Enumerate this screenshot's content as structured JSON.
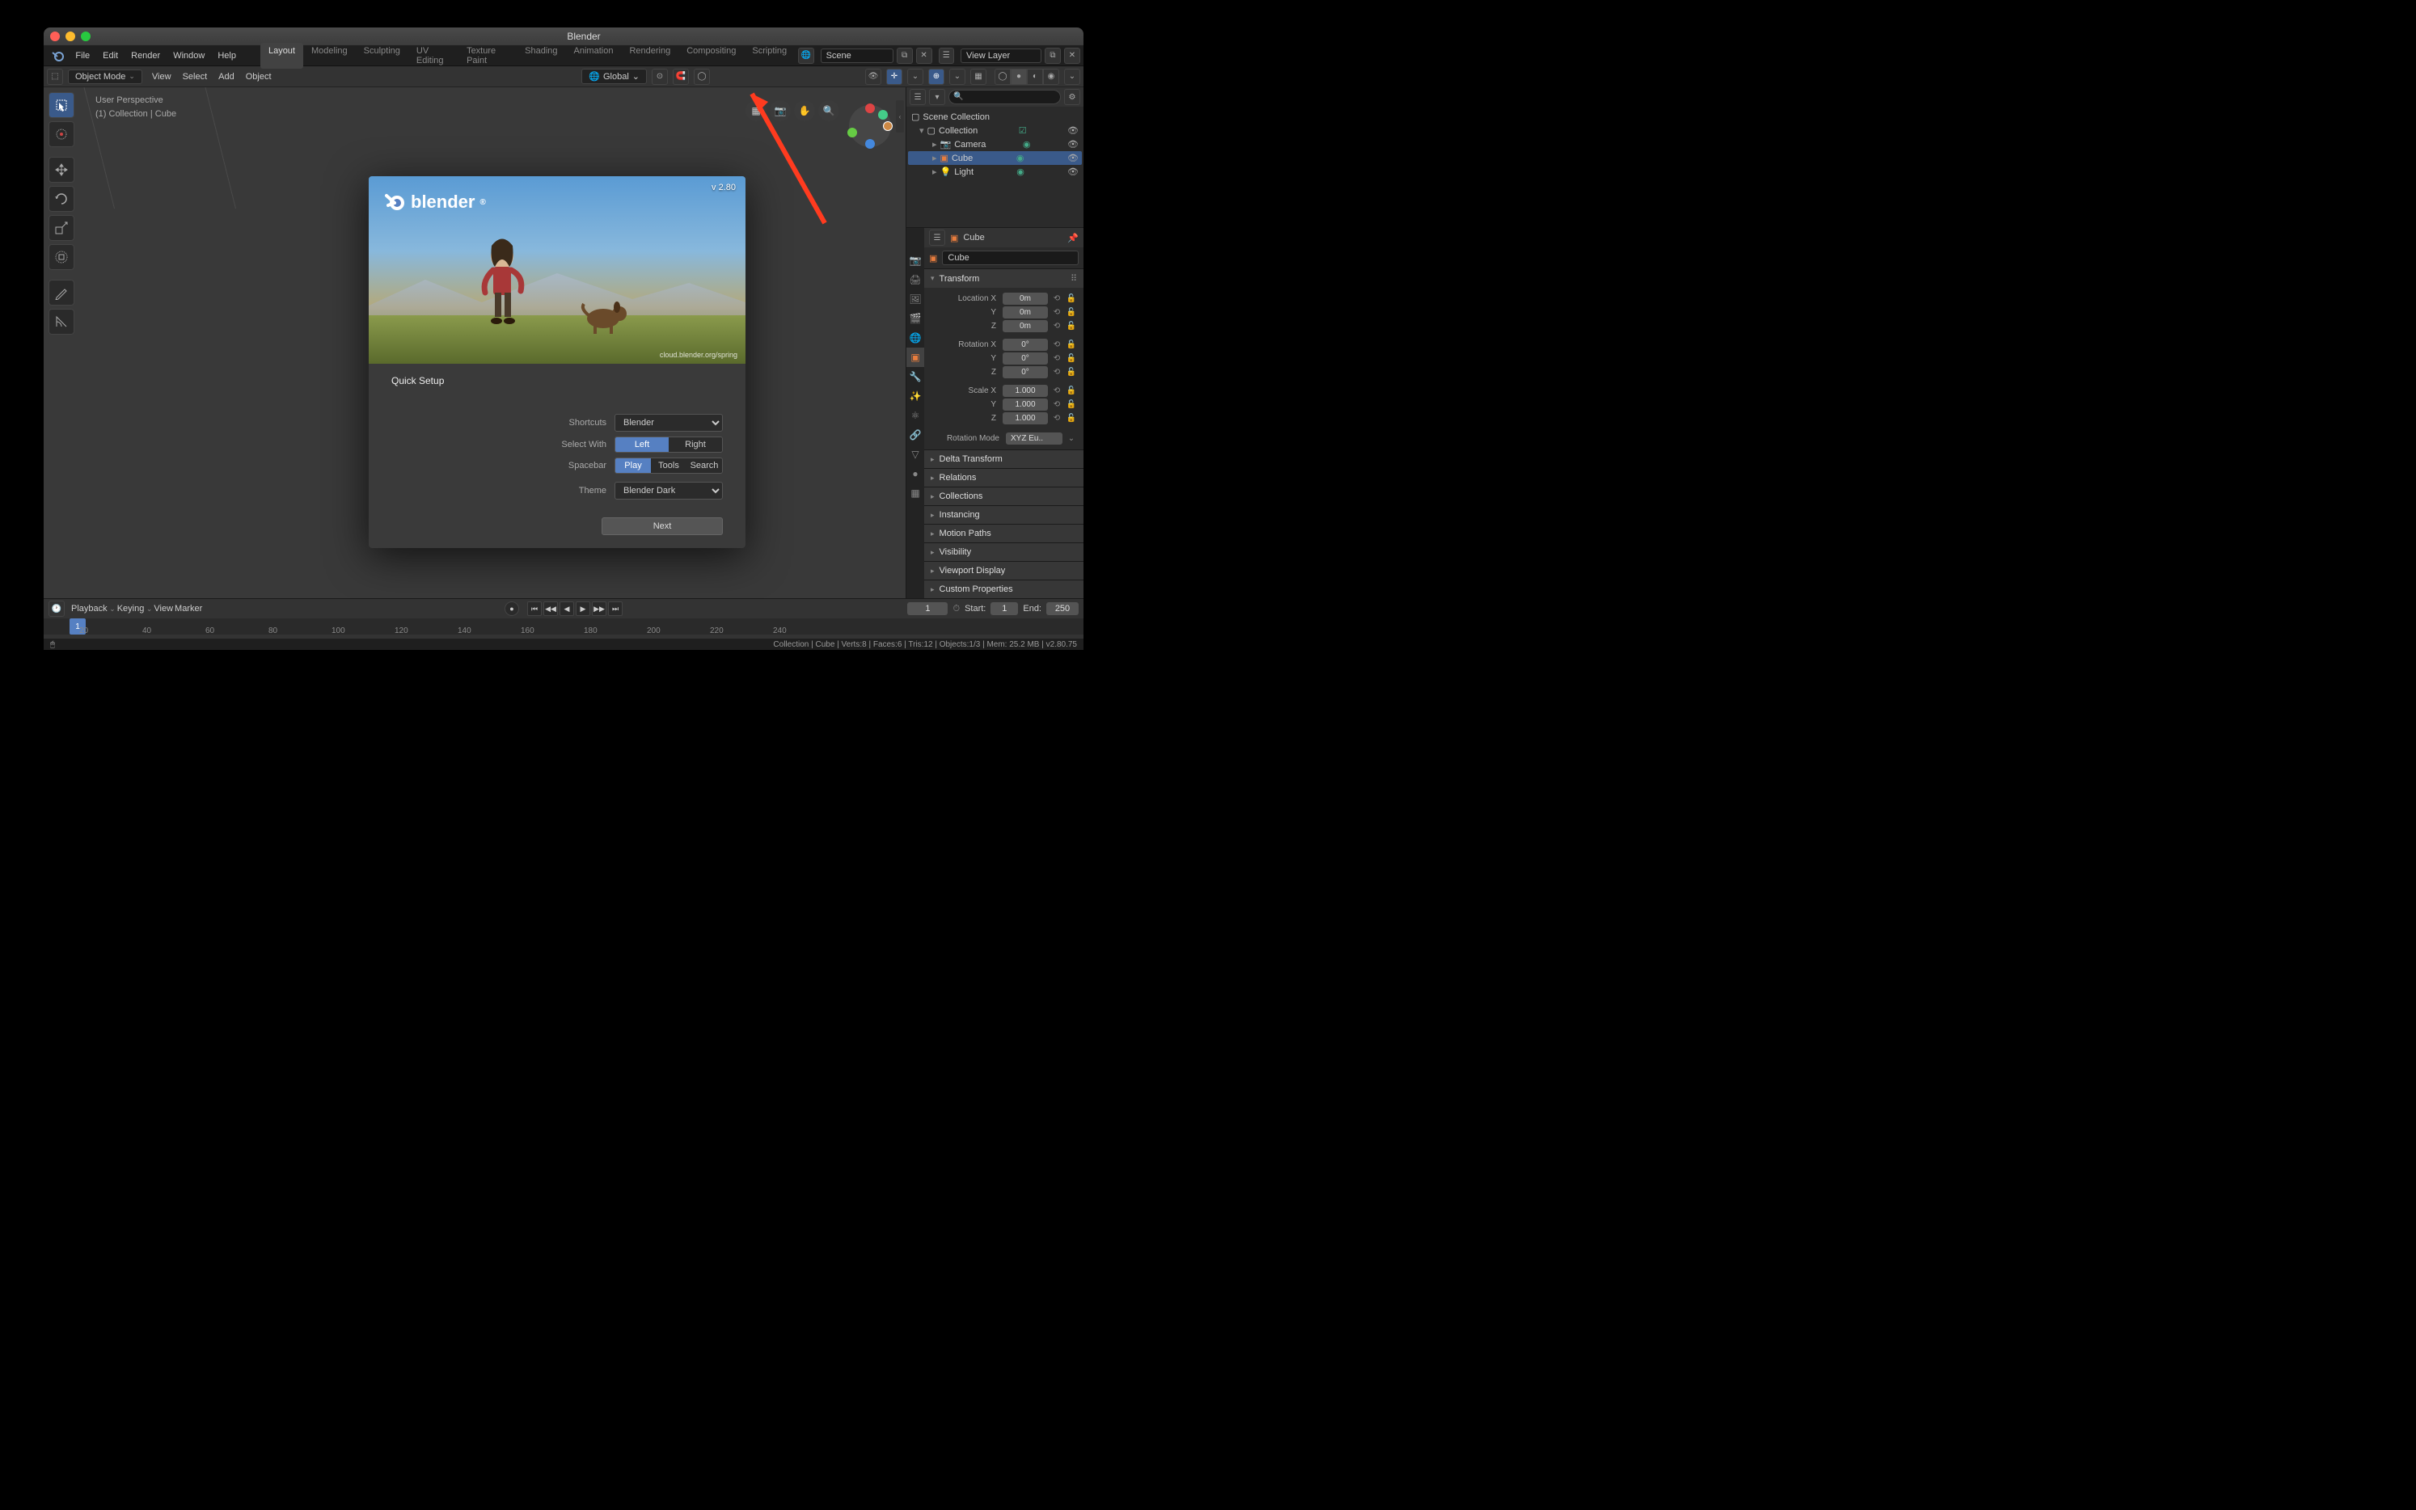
{
  "window_title": "Blender",
  "top_menus": [
    "File",
    "Edit",
    "Render",
    "Window",
    "Help"
  ],
  "workspace_tabs": [
    "Layout",
    "Modeling",
    "Sculpting",
    "UV Editing",
    "Texture Paint",
    "Shading",
    "Animation",
    "Rendering",
    "Compositing",
    "Scripting"
  ],
  "active_workspace": "Layout",
  "scene_name": "Scene",
  "view_layer_name": "View Layer",
  "toolbar": {
    "mode": "Object Mode",
    "menus": [
      "View",
      "Select",
      "Add",
      "Object"
    ],
    "orientation": "Global"
  },
  "viewport_info": {
    "line1": "User Perspective",
    "line2": "(1) Collection | Cube"
  },
  "splash": {
    "version": "v 2.80",
    "credit": "cloud.blender.org/spring",
    "title": "Quick Setup",
    "shortcuts_label": "Shortcuts",
    "shortcuts_value": "Blender",
    "select_with_label": "Select With",
    "select_with_options": [
      "Left",
      "Right"
    ],
    "select_with_active": "Left",
    "spacebar_label": "Spacebar",
    "spacebar_options": [
      "Play",
      "Tools",
      "Search"
    ],
    "spacebar_active": "Play",
    "theme_label": "Theme",
    "theme_value": "Blender Dark",
    "next": "Next"
  },
  "outliner": {
    "root": "Scene Collection",
    "collection": "Collection",
    "items": [
      {
        "name": "Camera",
        "icon": "📷",
        "color": "#7fbf7f"
      },
      {
        "name": "Cube",
        "icon": "▣",
        "color": "#e87d3e"
      },
      {
        "name": "Light",
        "icon": "💡",
        "color": "#e8a33e"
      }
    ],
    "selected": "Cube"
  },
  "properties": {
    "object_name": "Cube",
    "transform_label": "Transform",
    "location": {
      "x": "0m",
      "y": "0m",
      "z": "0m"
    },
    "rotation": {
      "x": "0°",
      "y": "0°",
      "z": "0°"
    },
    "scale": {
      "x": "1.000",
      "y": "1.000",
      "z": "1.000"
    },
    "rotation_mode_label": "Rotation Mode",
    "rotation_mode_value": "XYZ Eu..",
    "panels": [
      "Delta Transform",
      "Relations",
      "Collections",
      "Instancing",
      "Motion Paths",
      "Visibility",
      "Viewport Display",
      "Custom Properties"
    ]
  },
  "timeline": {
    "menus": [
      "Playback",
      "Keying",
      "View",
      "Marker"
    ],
    "current_frame": "1",
    "start_label": "Start:",
    "start": "1",
    "end_label": "End:",
    "end": "250",
    "ticks": [
      20,
      40,
      60,
      80,
      100,
      120,
      140,
      160,
      180,
      200,
      220,
      240
    ]
  },
  "status": "Collection | Cube | Verts:8 | Faces:6 | Tris:12 | Objects:1/3 | Mem: 25.2 MB | v2.80.75"
}
